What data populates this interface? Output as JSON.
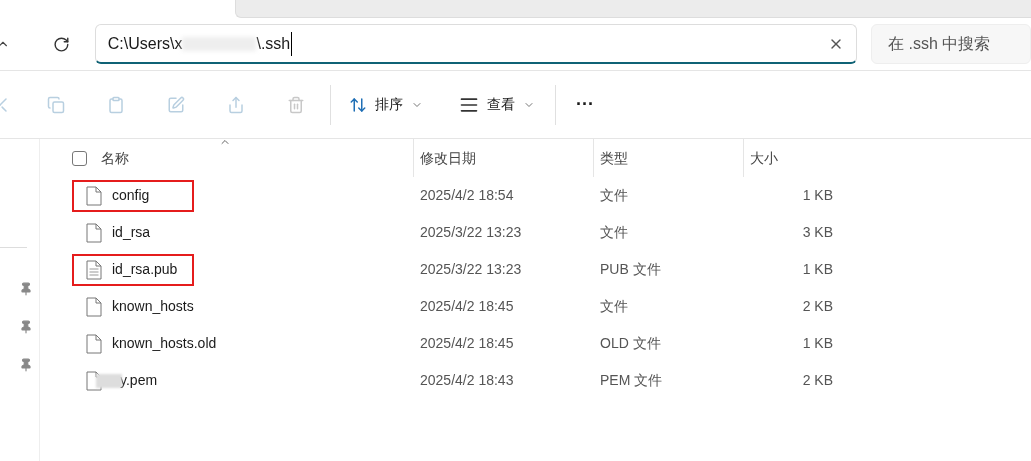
{
  "address_bar": {
    "path_start": "C:\\Users\\x",
    "path_end": "\\.ssh",
    "redacted": true
  },
  "search": {
    "placeholder": "在 .ssh 中搜索"
  },
  "toolbar": {
    "sort": "排序",
    "view": "查看",
    "more": "···"
  },
  "select_all": {
    "checked": false
  },
  "columns": [
    {
      "label": "名称",
      "sorted": true
    },
    {
      "label": "修改日期",
      "sorted": false
    },
    {
      "label": "类型",
      "sorted": false
    },
    {
      "label": "大小",
      "sorted": false
    }
  ],
  "files": [
    {
      "name": "config",
      "date": "2025/4/2 18:54",
      "type": "文件",
      "size": "1 KB",
      "kind": "blank",
      "highlighted": true,
      "redacted": false
    },
    {
      "name": "id_rsa",
      "date": "2025/3/22 13:23",
      "type": "文件",
      "size": "3 KB",
      "kind": "blank",
      "highlighted": false,
      "redacted": false
    },
    {
      "name": "id_rsa.pub",
      "date": "2025/3/22 13:23",
      "type": "PUB 文件",
      "size": "1 KB",
      "kind": "text",
      "highlighted": true,
      "redacted": false
    },
    {
      "name": "known_hosts",
      "date": "2025/4/2 18:45",
      "type": "文件",
      "size": "2 KB",
      "kind": "blank",
      "highlighted": false,
      "redacted": false
    },
    {
      "name": "known_hosts.old",
      "date": "2025/4/2 18:45",
      "type": "OLD 文件",
      "size": "1 KB",
      "kind": "blank",
      "highlighted": false,
      "redacted": false
    },
    {
      "name": "y.pem",
      "date": "2025/4/2 18:43",
      "type": "PEM 文件",
      "size": "2 KB",
      "kind": "blank",
      "highlighted": false,
      "redacted": true
    }
  ]
}
